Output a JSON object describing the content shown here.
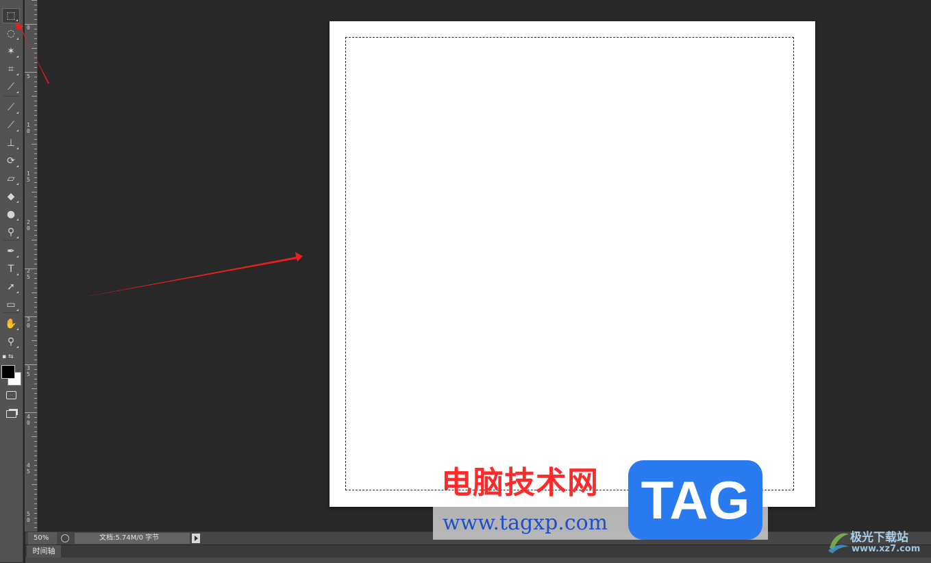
{
  "toolbox": {
    "tools": [
      {
        "name": "rectangular-marquee-tool",
        "icon": "marquee-icon",
        "glyph": "⬚",
        "active": true
      },
      {
        "name": "lasso-tool",
        "icon": "lasso-icon",
        "glyph": "◌"
      },
      {
        "name": "magic-wand-tool",
        "icon": "magic-wand-icon",
        "glyph": "✶"
      },
      {
        "name": "crop-tool",
        "icon": "crop-icon",
        "glyph": "⌗"
      },
      {
        "name": "eyedropper-tool",
        "icon": "eyedropper-icon",
        "glyph": "⟋"
      },
      {
        "name": "healing-brush-tool",
        "icon": "bandage-icon",
        "glyph": "⟋"
      },
      {
        "name": "brush-tool",
        "icon": "brush-icon",
        "glyph": "⟋"
      },
      {
        "name": "clone-stamp-tool",
        "icon": "stamp-icon",
        "glyph": "⊥"
      },
      {
        "name": "history-brush-tool",
        "icon": "history-brush-icon",
        "glyph": "⟳"
      },
      {
        "name": "eraser-tool",
        "icon": "eraser-icon",
        "glyph": "▱"
      },
      {
        "name": "paint-bucket-tool",
        "icon": "paint-bucket-icon",
        "glyph": "◆"
      },
      {
        "name": "blur-tool",
        "icon": "blur-drop-icon",
        "glyph": "●"
      },
      {
        "name": "dodge-tool",
        "icon": "dodge-icon",
        "glyph": "⚲"
      },
      {
        "name": "pen-tool",
        "icon": "pen-icon",
        "glyph": "✒"
      },
      {
        "name": "type-tool",
        "icon": "type-icon",
        "glyph": "T"
      },
      {
        "name": "path-selection-tool",
        "icon": "arrow-pointer-icon",
        "glyph": "➚"
      },
      {
        "name": "shape-tool",
        "icon": "rounded-rect-icon",
        "glyph": "▭"
      },
      {
        "name": "hand-tool",
        "icon": "hand-icon",
        "glyph": "✋"
      },
      {
        "name": "zoom-tool",
        "icon": "zoom-icon",
        "glyph": "⚲"
      }
    ],
    "foreground_color": "#000000",
    "background_color": "#ffffff"
  },
  "ruler": {
    "labels": [
      "0",
      "5",
      "10",
      "15",
      "20",
      "25",
      "30",
      "35",
      "40",
      "45",
      "50"
    ]
  },
  "status_bar": {
    "zoom": "50%",
    "doc_info": "文档:5.74M/0 字节"
  },
  "timeline": {
    "tab_label": "时间轴"
  },
  "watermark": {
    "title": "电脑技术网",
    "url": "www.tagxp.com",
    "tag": "TAG",
    "site_cn": "极光下载站",
    "site_url": "www.xz7.com"
  },
  "colors": {
    "arrow": "#e8201e",
    "canvas": "#ffffff",
    "workspace": "#282828",
    "tag_blue": "#2a7bf0"
  }
}
